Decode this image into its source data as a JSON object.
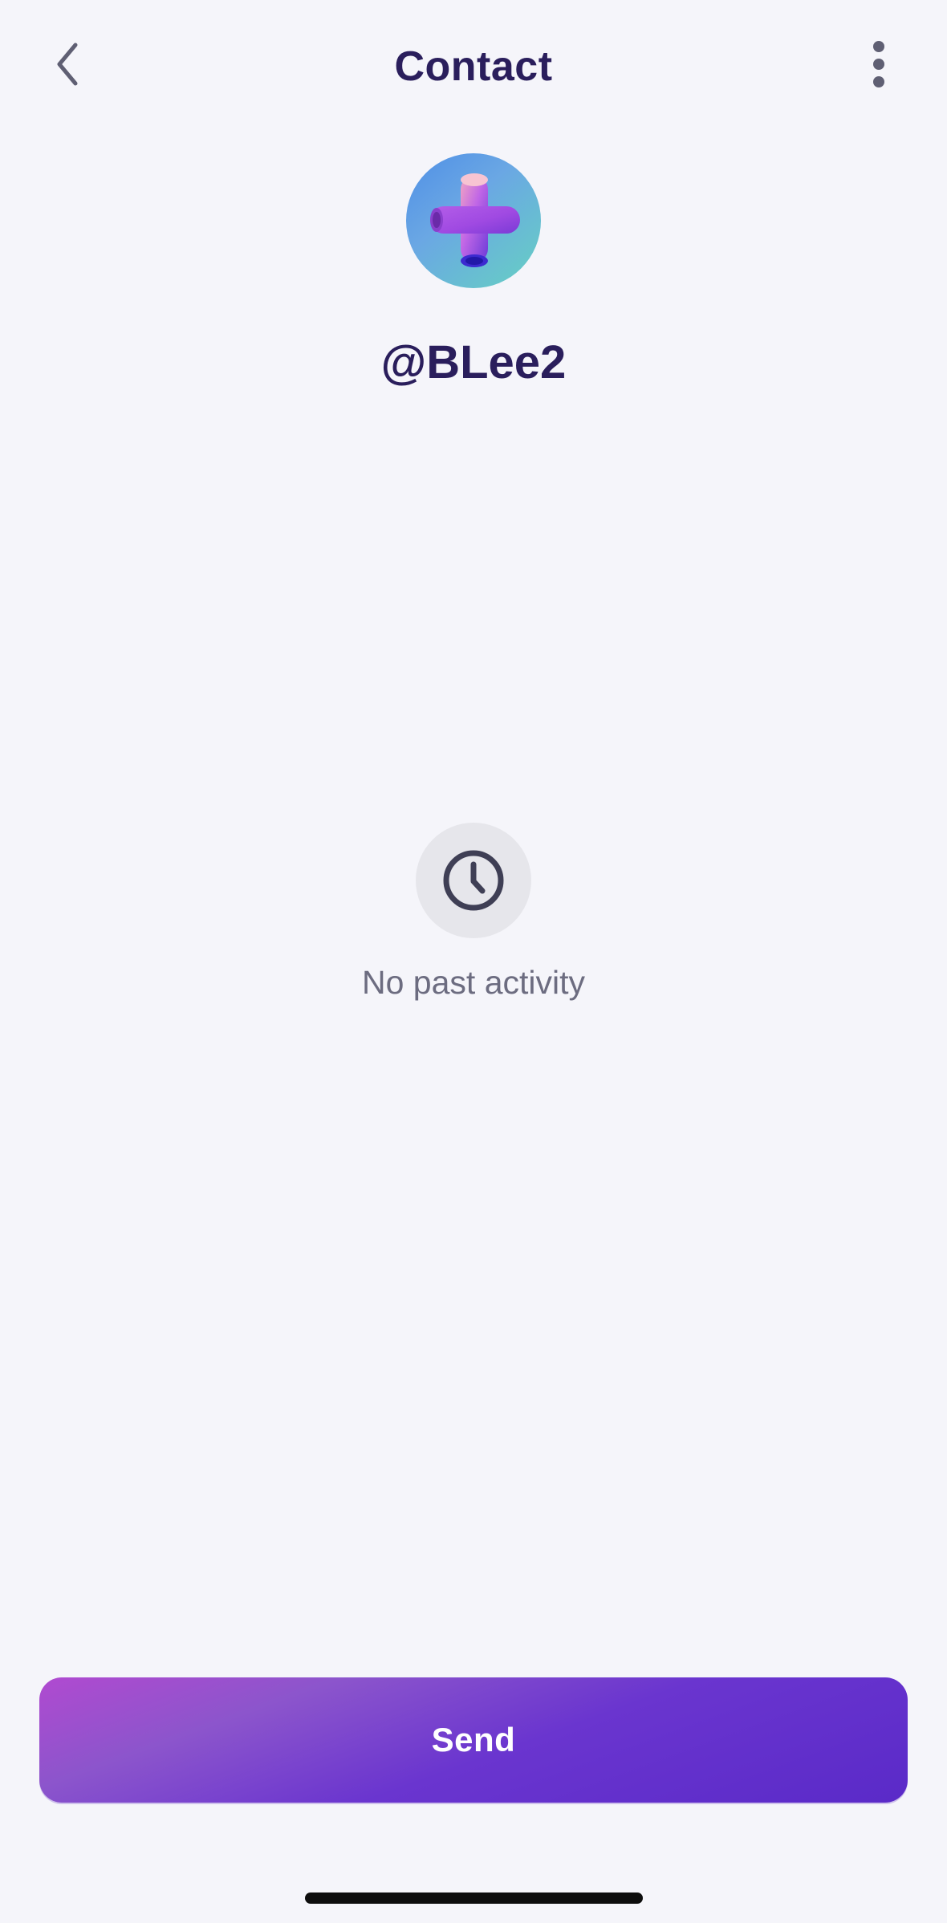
{
  "header": {
    "title": "Contact",
    "back_icon": "chevron-left-icon",
    "more_icon": "more-vertical-icon"
  },
  "contact": {
    "avatar_icon": "plus-3d-avatar-icon",
    "username": "@BLee2"
  },
  "activity": {
    "empty_icon": "clock-icon",
    "empty_text": "No past activity"
  },
  "actions": {
    "send_label": "Send"
  },
  "colors": {
    "background": "#f5f5fa",
    "title_text": "#2a1e5c",
    "muted_text": "#6c6c80",
    "send_gradient_start": "#b04ad0",
    "send_gradient_end": "#5a2ac8"
  }
}
